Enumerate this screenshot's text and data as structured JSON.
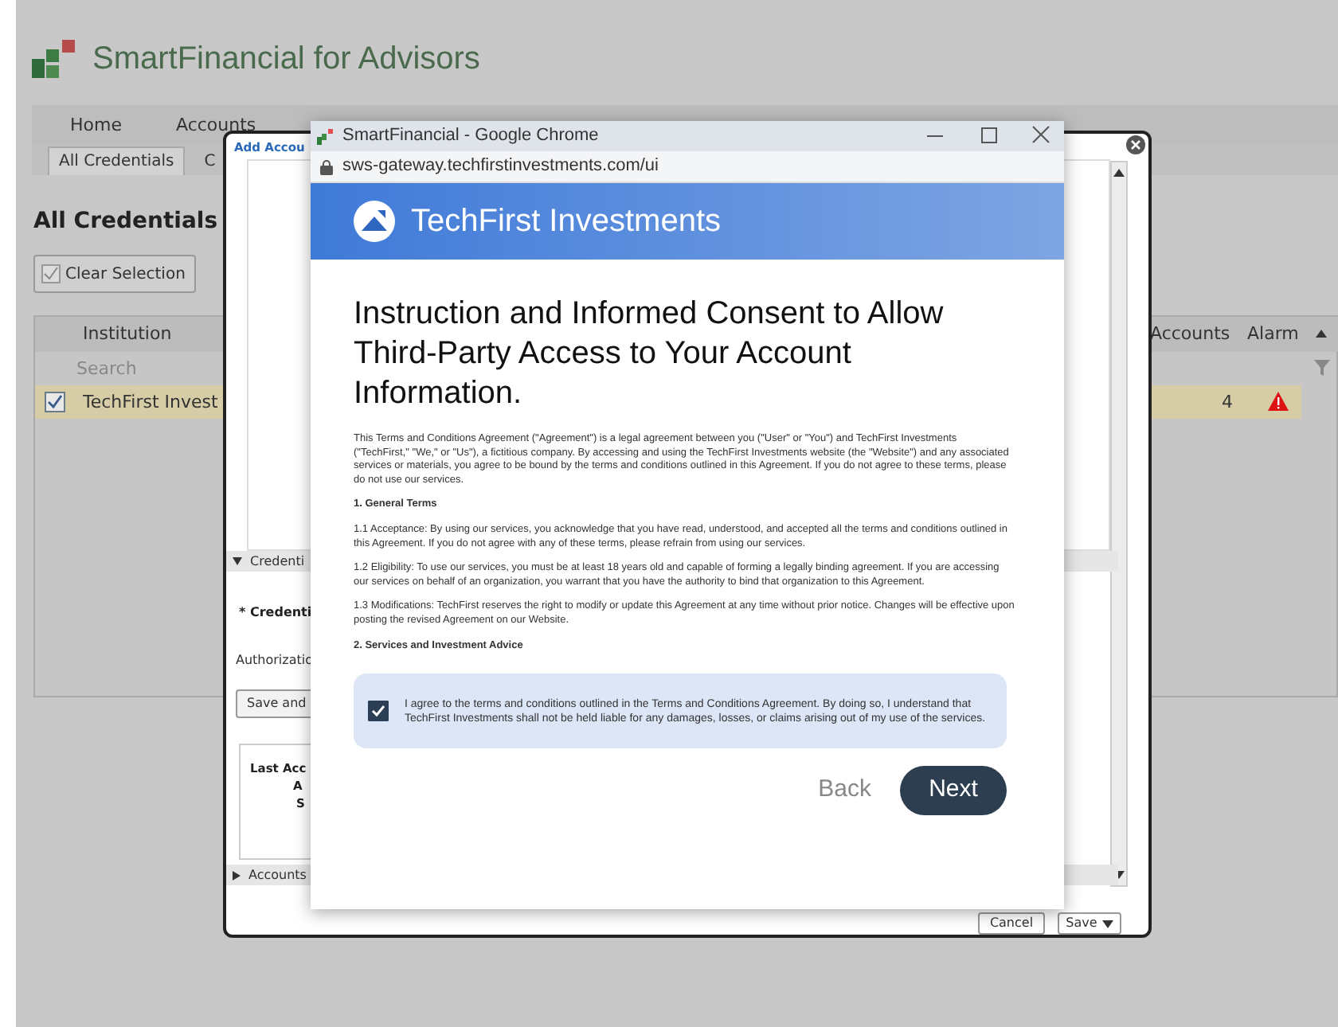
{
  "app": {
    "title": "SmartFinancial for Advisors",
    "tabs": [
      {
        "label": "Home",
        "selected": false
      },
      {
        "label": "Accounts",
        "selected": false
      }
    ],
    "subtabs": [
      {
        "label": "All Credentials",
        "selected": true
      },
      {
        "label": "C",
        "selected": false
      }
    ],
    "heading": "All Credentials",
    "clear_button": "Clear Selection",
    "table": {
      "columns": [
        "Institution",
        "Accounts",
        "Alarm"
      ],
      "search_placeholder": "Search",
      "rows": [
        {
          "selected": true,
          "institution": "TechFirst Invest",
          "accounts": "4",
          "alarm": true
        }
      ]
    }
  },
  "dialog": {
    "title": "Add Accou",
    "sections": [
      {
        "label": "Credenti",
        "expanded": true
      },
      {
        "label": "Accounts",
        "expanded": false
      }
    ],
    "field_label": "* Credenti",
    "auth_label": "Authorizatio",
    "save_and": "Save and",
    "info_lines": [
      "Last Acc",
      "A",
      "S"
    ],
    "buttons": [
      {
        "label": "Cancel",
        "kind": "plain"
      },
      {
        "label": "Save",
        "kind": "menu"
      }
    ]
  },
  "browser": {
    "title": "SmartFinancial - Google Chrome",
    "url": "sws-gateway.techfirstinvestments.com/ui",
    "brand": "TechFirst Investments",
    "heading": "Instruction and Informed Consent to Allow Third-Party Access to Your Account Information.",
    "terms": [
      {
        "kind": "para",
        "text": "This Terms and Conditions Agreement (\"Agreement\") is a legal agreement between you (\"User\" or \"You\") and TechFirst Investments (\"TechFirst,\" \"We,\" or \"Us\"), a fictitious company. By accessing and using the TechFirst Investments website (the \"Website\") and any associated services or materials, you agree to be bound by the terms and conditions outlined in this Agreement. If you do not agree to these terms, please do not use our services."
      },
      {
        "kind": "heading",
        "text": "1. General Terms"
      },
      {
        "kind": "para",
        "text": "1.1 Acceptance: By using our services, you acknowledge that you have read, understood, and accepted all the terms and conditions outlined in this Agreement. If you do not agree with any of these terms, please refrain from using our services."
      },
      {
        "kind": "para",
        "text": "1.2 Eligibility: To use our services, you must be at least 18 years old and capable of forming a legally binding agreement. If you are accessing our services on behalf of an organization, you warrant that you have the authority to bind that organization to this Agreement."
      },
      {
        "kind": "para",
        "text": "1.3 Modifications: TechFirst reserves the right to modify or update this Agreement at any time without prior notice. Changes will be effective upon posting the revised Agreement on our Website."
      },
      {
        "kind": "heading",
        "text": "2. Services and Investment Advice"
      }
    ],
    "consent": {
      "text": "I agree to the terms and conditions outlined in the Terms and Conditions Agreement. By doing so, I understand that TechFirst Investments shall not be held liable for any damages, losses, or claims arising out of my use of the services.",
      "checked": true
    },
    "back": "Back",
    "next": "Next"
  }
}
